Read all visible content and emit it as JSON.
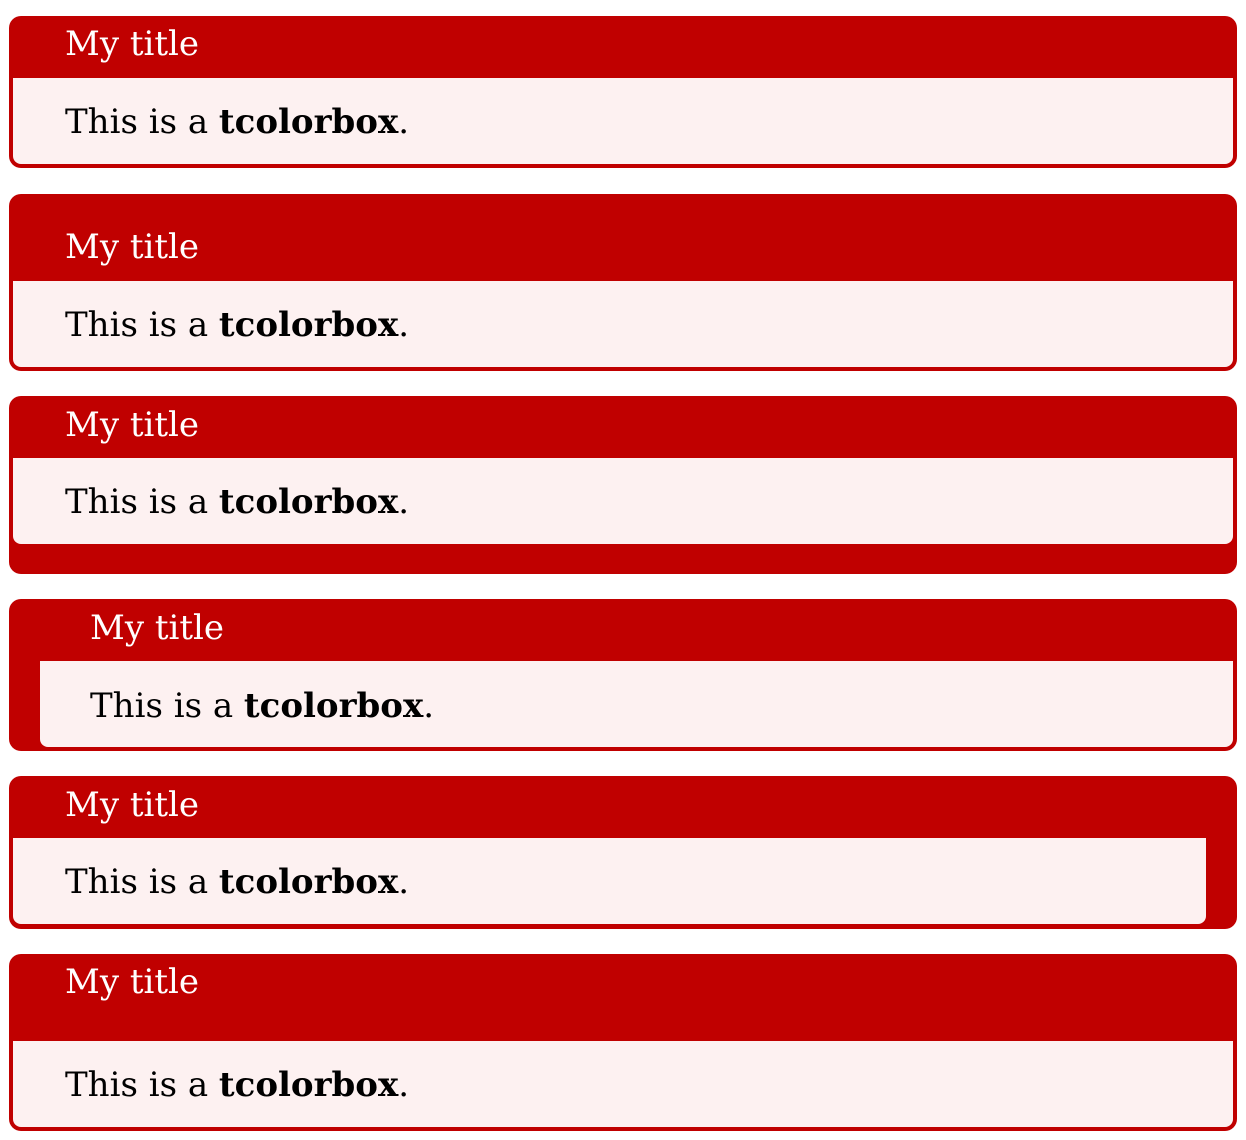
{
  "boxes": [
    {
      "title": "My title",
      "text_before": "This is a ",
      "text_bold": "tcolorbox",
      "text_after": "."
    },
    {
      "title": "My title",
      "text_before": "This is a ",
      "text_bold": "tcolorbox",
      "text_after": "."
    },
    {
      "title": "My title",
      "text_before": "This is a ",
      "text_bold": "tcolorbox",
      "text_after": "."
    },
    {
      "title": "My title",
      "text_before": "This is a ",
      "text_bold": "tcolorbox",
      "text_after": "."
    },
    {
      "title": "My title",
      "text_before": "This is a ",
      "text_bold": "tcolorbox",
      "text_after": "."
    },
    {
      "title": "My title",
      "text_before": "This is a ",
      "text_bold": "tcolorbox",
      "text_after": "."
    }
  ],
  "colors": {
    "frame": "#c00000",
    "background": "#fdf1f1",
    "title_text": "#ffffff",
    "body_text": "#000000"
  }
}
